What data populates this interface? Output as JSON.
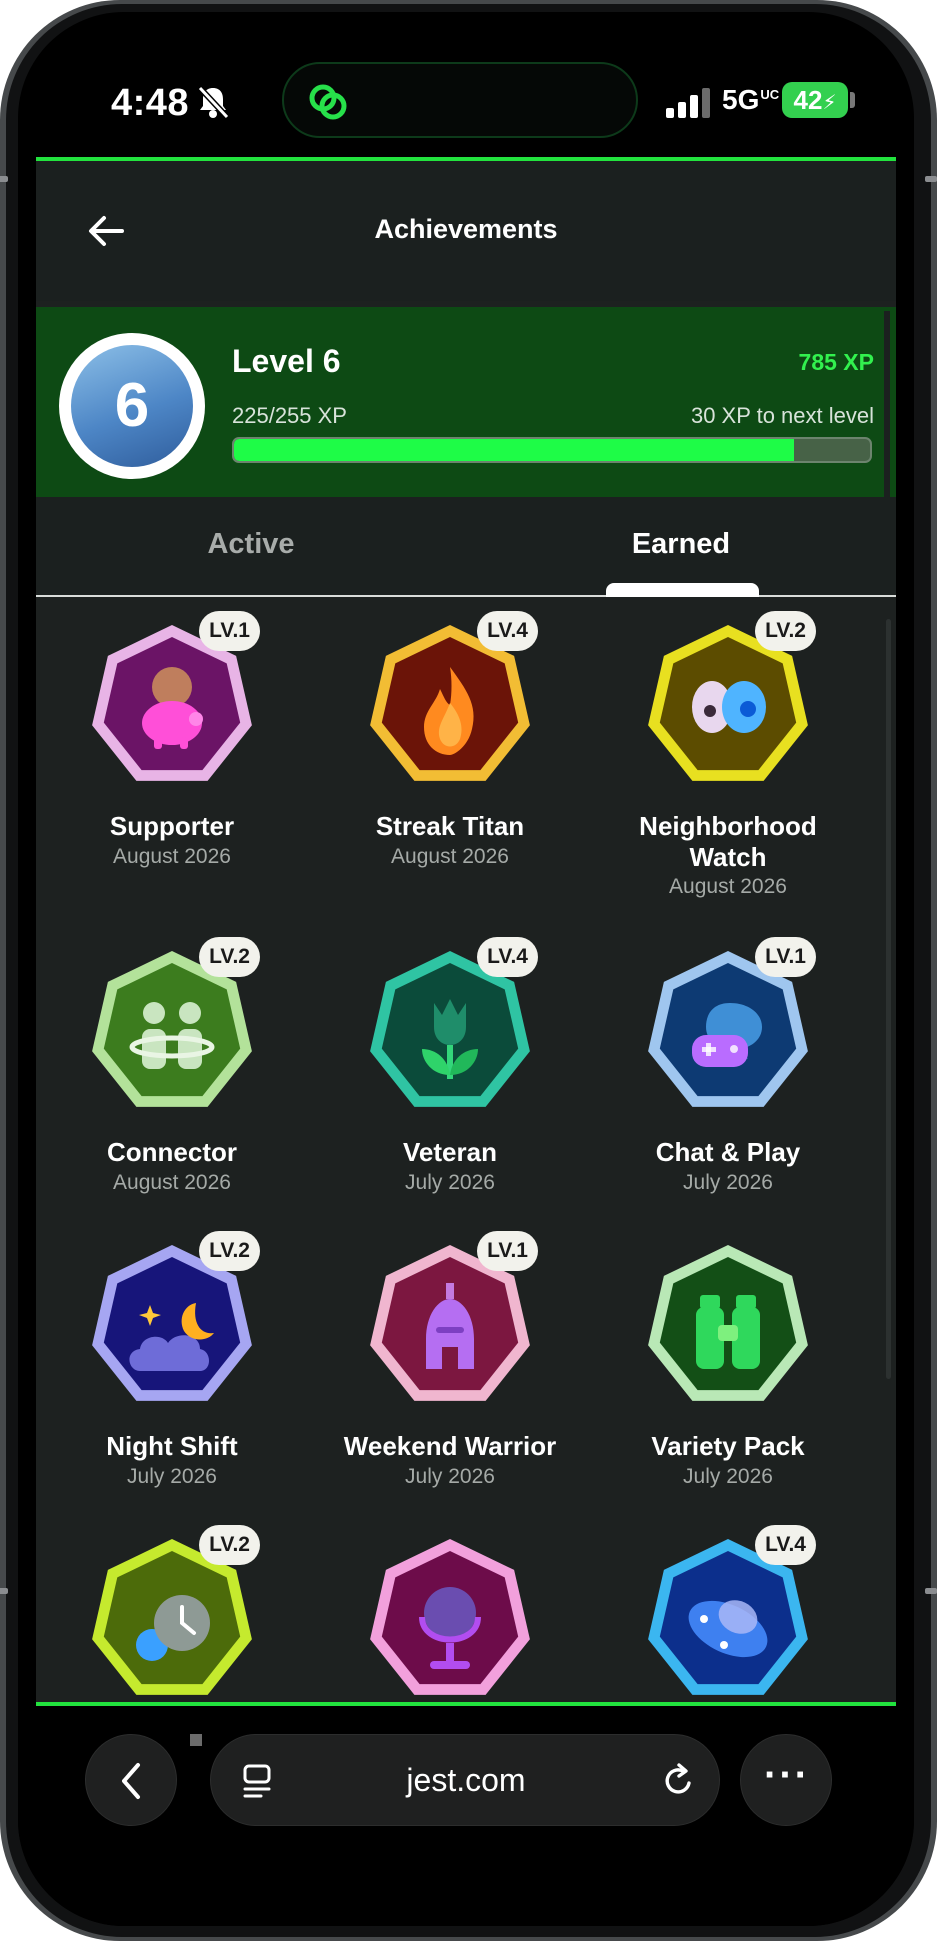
{
  "status_bar": {
    "time": "4:48",
    "network": "5G",
    "network_sup": "UC",
    "battery": "42"
  },
  "header": {
    "title": "Achievements"
  },
  "level": {
    "badge_number": "6",
    "title": "Level 6",
    "total_xp": "785 XP",
    "progress_text": "225/255 XP",
    "to_next": "30 XP to next level",
    "progress_fraction": 0.88
  },
  "tabs": [
    {
      "label": "Active",
      "selected": false
    },
    {
      "label": "Earned",
      "selected": true
    }
  ],
  "badges": [
    {
      "name": "Supporter",
      "date": "August 2026",
      "level": "LV.1",
      "icon": "piggy-bank-icon",
      "rim": "#e8b4e6",
      "fill": "#6b1466"
    },
    {
      "name": "Streak Titan",
      "date": "August 2026",
      "level": "LV.4",
      "icon": "flame-icon",
      "rim": "#f2bd34",
      "fill": "#6b1408"
    },
    {
      "name": "Neighborhood Watch",
      "date": "August 2026",
      "level": "LV.2",
      "icon": "eyes-icon",
      "rim": "#e8e020",
      "fill": "#5c4c00"
    },
    {
      "name": "Connector",
      "date": "August 2026",
      "level": "LV.2",
      "icon": "people-icon",
      "rim": "#b3e29a",
      "fill": "#3c7c1e"
    },
    {
      "name": "Veteran",
      "date": "July 2026",
      "level": "LV.4",
      "icon": "tulip-icon",
      "rim": "#2fc4a3",
      "fill": "#0b4b3a"
    },
    {
      "name": "Chat & Play",
      "date": "July 2026",
      "level": "LV.1",
      "icon": "gamepad-chat-icon",
      "rim": "#9fc6ef",
      "fill": "#0d3a73"
    },
    {
      "name": "Night Shift",
      "date": "July 2026",
      "level": "LV.2",
      "icon": "moon-cloud-icon",
      "rim": "#a6a6f2",
      "fill": "#17157a"
    },
    {
      "name": "Weekend Warrior",
      "date": "July 2026",
      "level": "LV.1",
      "icon": "helmet-icon",
      "rim": "#f0b6cf",
      "fill": "#7c1740"
    },
    {
      "name": "Variety Pack",
      "date": "July 2026",
      "level": "",
      "icon": "binoculars-icon",
      "rim": "#b9e8b6",
      "fill": "#134f16"
    },
    {
      "name": "",
      "date": "",
      "level": "LV.2",
      "icon": "clock-gear-icon",
      "rim": "#c5ea2e",
      "fill": "#4c6b0a"
    },
    {
      "name": "",
      "date": "",
      "level": "",
      "icon": "microphone-icon",
      "rim": "#f2a0dc",
      "fill": "#6d0c4a"
    },
    {
      "name": "",
      "date": "",
      "level": "LV.4",
      "icon": "ufo-icon",
      "rim": "#3bb6f0",
      "fill": "#0c2f8c"
    }
  ],
  "browser": {
    "url": "jest.com"
  }
}
